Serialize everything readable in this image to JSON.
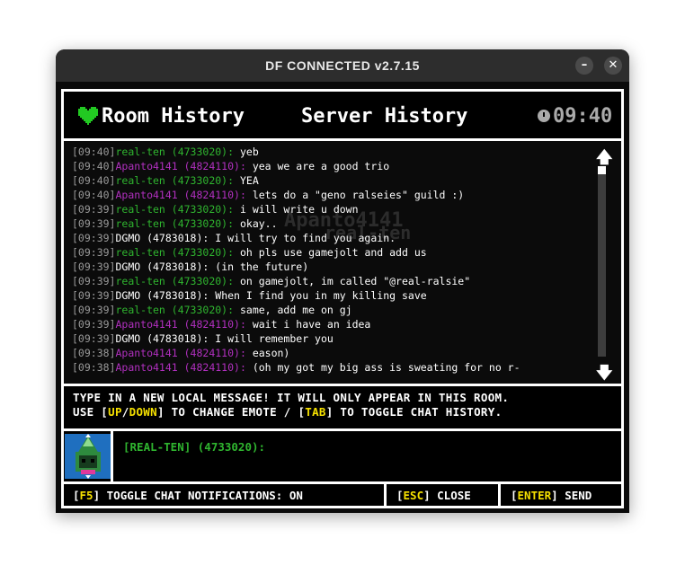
{
  "window": {
    "title": "DF CONNECTED v2.7.15",
    "minimize_label": "–",
    "close_label": "✕"
  },
  "header": {
    "room_tab": "Room History",
    "server_tab": "Server History",
    "clock": "09:40"
  },
  "background_text": {
    "line1": "Apanto4141",
    "line2": "real-ten"
  },
  "messages": [
    {
      "time": "[09:40]",
      "user": "real-ten (4733020):",
      "user_color": "green",
      "text": "yeb"
    },
    {
      "time": "[09:40]",
      "user": "Apanto4141 (4824110):",
      "user_color": "purple",
      "text": "yea we are a good trio"
    },
    {
      "time": "[09:40]",
      "user": "real-ten (4733020):",
      "user_color": "green",
      "text": "YEA"
    },
    {
      "time": "[09:40]",
      "user": "Apanto4141 (4824110):",
      "user_color": "purple",
      "text": "lets do a \"geno ralseies\" guild :)"
    },
    {
      "time": "[09:39]",
      "user": "real-ten (4733020):",
      "user_color": "green",
      "text": "i will write u down"
    },
    {
      "time": "[09:39]",
      "user": "real-ten (4733020):",
      "user_color": "green",
      "text": "okay.."
    },
    {
      "time": "[09:39]",
      "user": "DGMO (4783018):",
      "user_color": "white",
      "text": "I will try to find you again."
    },
    {
      "time": "[09:39]",
      "user": "real-ten (4733020):",
      "user_color": "green",
      "text": "oh pls use gamejolt and add us"
    },
    {
      "time": "[09:39]",
      "user": "DGMO (4783018):",
      "user_color": "white",
      "text": "(in the future)"
    },
    {
      "time": "[09:39]",
      "user": "real-ten (4733020):",
      "user_color": "green",
      "text": "on gamejolt, im called \"@real-ralsie\""
    },
    {
      "time": "[09:39]",
      "user": "DGMO (4783018):",
      "user_color": "white",
      "text": "When I find you in my killing save"
    },
    {
      "time": "[09:39]",
      "user": "real-ten (4733020):",
      "user_color": "green",
      "text": "same, add me on gj"
    },
    {
      "time": "[09:39]",
      "user": "Apanto4141 (4824110):",
      "user_color": "purple",
      "text": "wait i have an idea"
    },
    {
      "time": "[09:39]",
      "user": "DGMO (4783018):",
      "user_color": "white",
      "text": "I will remember you"
    },
    {
      "time": "[09:38]",
      "user": "Apanto4141 (4824110):",
      "user_color": "purple",
      "text": "eason)"
    },
    {
      "time": "[09:38]",
      "user": "Apanto4141 (4824110):",
      "user_color": "purple",
      "text": "(oh my got my big ass is sweating for no r-"
    }
  ],
  "scroll": {
    "up_icon": "arrow-up",
    "down_icon": "arrow-down",
    "position_fraction": 0
  },
  "info": {
    "line1": "TYPE IN A NEW LOCAL MESSAGE! IT WILL ONLY APPEAR IN THIS ROOM.",
    "line2_prefix": "USE [",
    "line2_up": "UP",
    "line2_slash": "/",
    "line2_down": "DOWN",
    "line2_mid": "] TO CHANGE EMOTE / [",
    "line2_tab": "TAB",
    "line2_suffix": "] TO TOGGLE CHAT HISTORY."
  },
  "input": {
    "prompt": "[REAL-TEN] (4733020):",
    "value": ""
  },
  "footer": {
    "notif_key": "F5",
    "notif_text": "] TOGGLE CHAT NOTIFICATIONS: ON",
    "close_key": "ESC",
    "close_text": "] CLOSE",
    "send_key": "ENTER",
    "send_text": "] SEND",
    "bracket_open": "["
  },
  "colors": {
    "green": "#2fb52f",
    "purple": "#b230c0",
    "yellow": "#f5e000",
    "timestamp": "#9a9a9a"
  }
}
